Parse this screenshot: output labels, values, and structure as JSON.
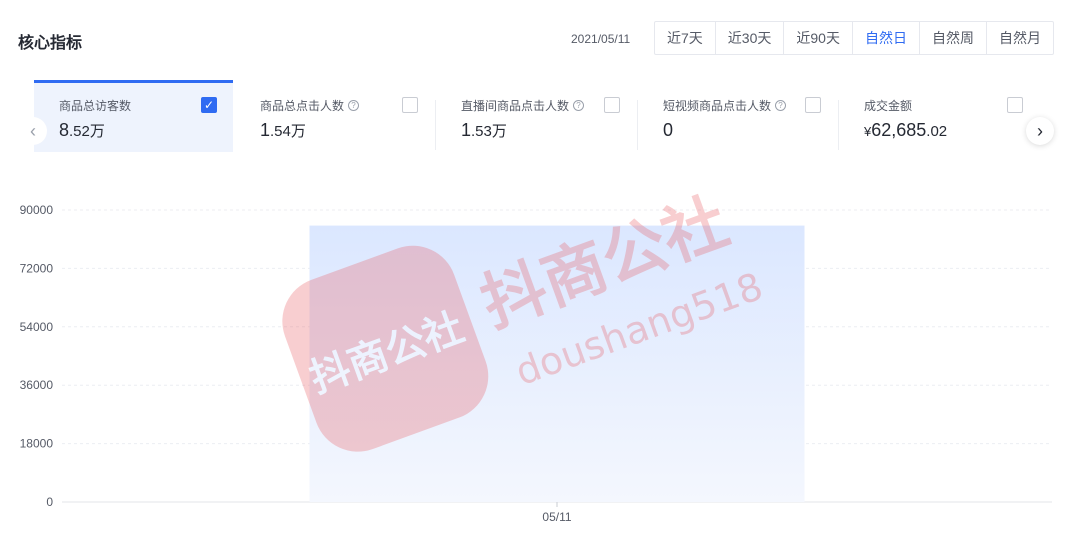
{
  "header": {
    "title": "核心指标",
    "date": "2021/05/11",
    "range_tabs": [
      {
        "label": "近7天",
        "active": false
      },
      {
        "label": "近30天",
        "active": false
      },
      {
        "label": "近90天",
        "active": false
      },
      {
        "label": "自然日",
        "active": true
      },
      {
        "label": "自然周",
        "active": false
      },
      {
        "label": "自然月",
        "active": false
      }
    ]
  },
  "metrics": [
    {
      "label": "商品总访客数",
      "value_main": "8",
      "value_rest": ".52",
      "unit": "万",
      "prefix": "",
      "help": false,
      "checked": true
    },
    {
      "label": "商品总点击人数",
      "value_main": "1",
      "value_rest": ".54",
      "unit": "万",
      "prefix": "",
      "help": true,
      "checked": false
    },
    {
      "label": "直播间商品点击人数",
      "value_main": "1",
      "value_rest": ".53",
      "unit": "万",
      "prefix": "",
      "help": true,
      "checked": false
    },
    {
      "label": "短视频商品点击人数",
      "value_main": "0",
      "value_rest": "",
      "unit": "",
      "prefix": "",
      "help": true,
      "checked": false
    },
    {
      "label": "成交金额",
      "value_main": "62,685",
      "value_rest": ".02",
      "unit": "",
      "prefix": "¥",
      "help": false,
      "checked": false
    }
  ],
  "icons": {
    "prev": "chevron-left-icon",
    "next": "chevron-right-icon",
    "help": "question-circle-icon",
    "check": "checkmark-icon"
  },
  "colors": {
    "accent": "#2f6bf2",
    "bar_top": "#dbe7ff",
    "bar_bottom": "#f4f7fe",
    "watermark": "#e8545a"
  },
  "chart_data": {
    "type": "bar",
    "categories": [
      "05/11"
    ],
    "series": [
      {
        "values": [
          85200
        ]
      }
    ],
    "yticks": [
      0,
      18000,
      36000,
      54000,
      72000,
      90000
    ],
    "ylim": [
      0,
      90000
    ],
    "grid": true
  },
  "watermark": {
    "badge_text": "抖商公社",
    "main_text": "抖商公社",
    "sub_text": "doushang518"
  }
}
